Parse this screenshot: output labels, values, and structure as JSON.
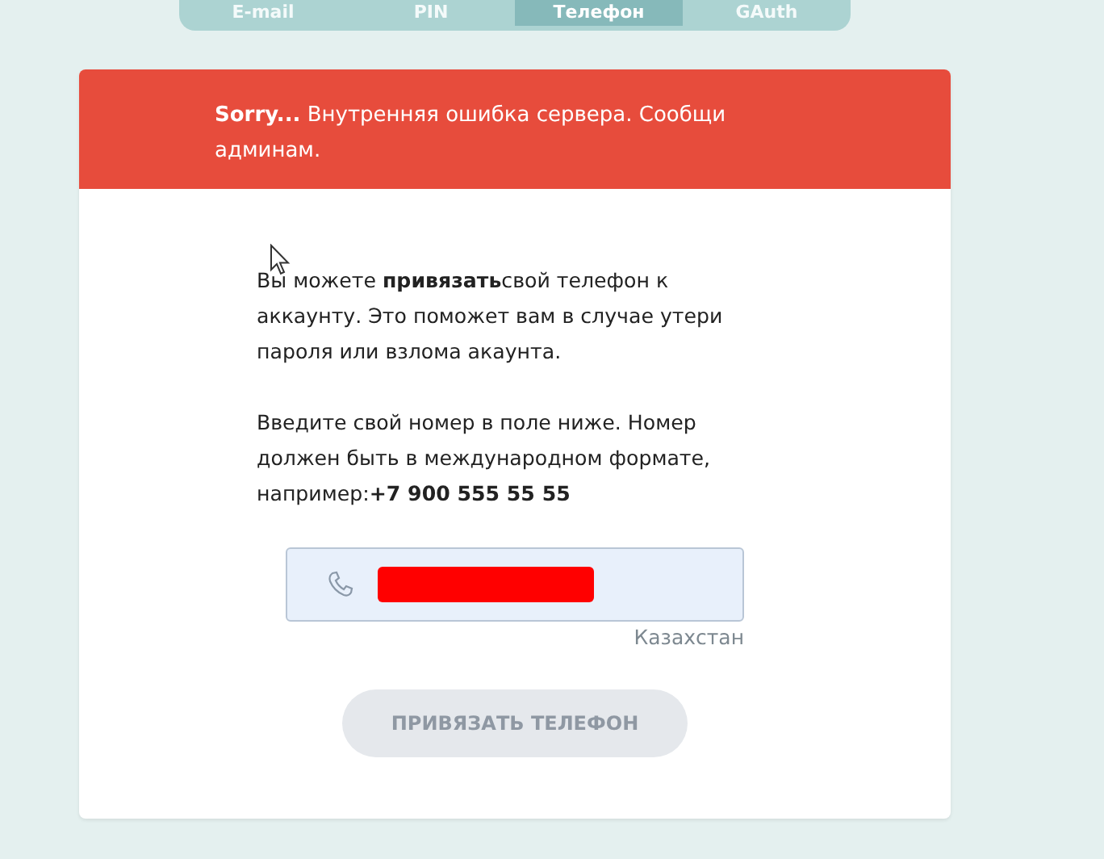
{
  "tabs": [
    {
      "label": "E-mail",
      "selected": false
    },
    {
      "label": "PIN",
      "selected": false
    },
    {
      "label": "Телефон",
      "selected": true
    },
    {
      "label": "GAuth",
      "selected": false
    }
  ],
  "alert": {
    "title": "Sorry...",
    "message": "Внутренняя ошибка сервера. Сообщи админам."
  },
  "intro": [
    "Вы можете **привязать**свой телефон к аккаунту. Это поможет вам в случае утери пароля или взлома акаунта.",
    "Введите свой номер в поле ниже. Номер должен быть в международном формате, например:**+7 900 555 55 55**"
  ],
  "phone_field": {
    "country": "Казахстан"
  },
  "submit_button": {
    "label": "ПРИВЯЗАТЬ ТЕЛЕФОН",
    "disabled": true
  }
}
